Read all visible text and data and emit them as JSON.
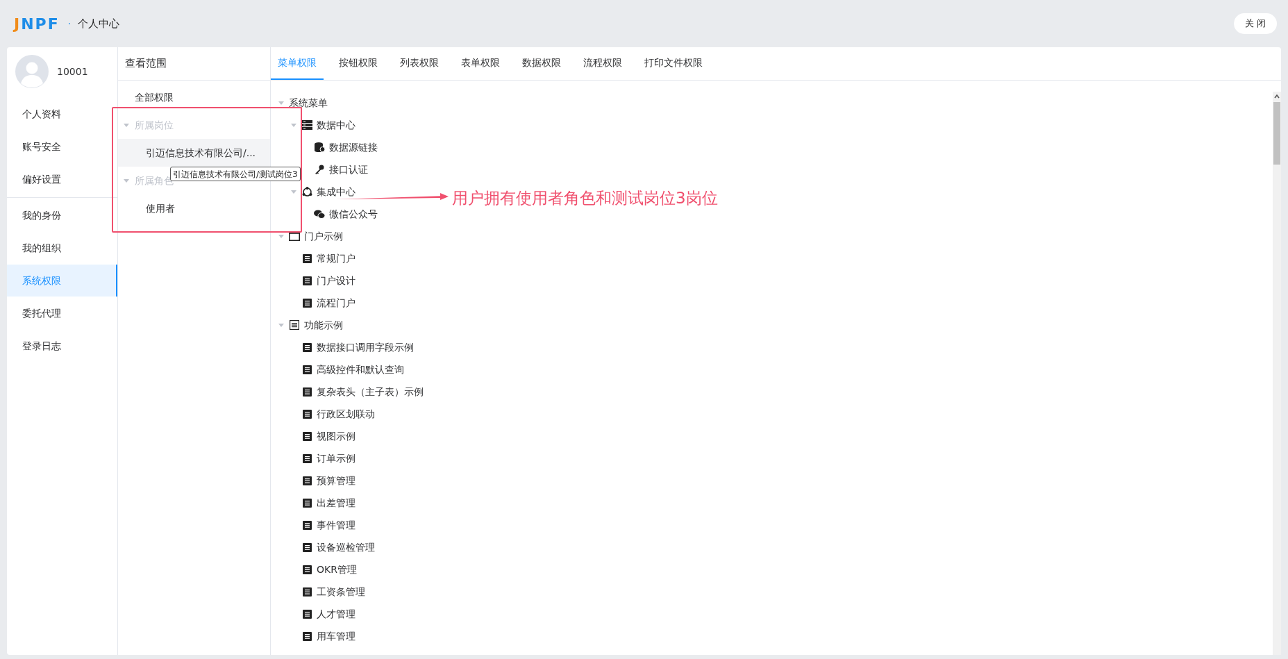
{
  "header": {
    "logo": "JNPF",
    "separator": "·",
    "title": "个人中心",
    "close_button": "关 闭"
  },
  "profile": {
    "user_id": "10001"
  },
  "sidebar": {
    "groups": [
      {
        "items": [
          {
            "label": "个人资料",
            "selected": false
          },
          {
            "label": "账号安全",
            "selected": false
          },
          {
            "label": "偏好设置",
            "selected": false
          }
        ]
      },
      {
        "items": [
          {
            "label": "我的身份",
            "selected": false
          },
          {
            "label": "我的组织",
            "selected": false
          },
          {
            "label": "系统权限",
            "selected": true
          },
          {
            "label": "委托代理",
            "selected": false
          },
          {
            "label": "登录日志",
            "selected": false
          }
        ]
      }
    ]
  },
  "scope": {
    "title": "查看范围",
    "items": [
      {
        "label": "全部权限",
        "kind": "item",
        "selected": false
      },
      {
        "label": "所属岗位",
        "kind": "group",
        "disabled": true,
        "expanded": true,
        "children": [
          {
            "label": "引迈信息技术有限公司/...",
            "selected": true
          }
        ]
      },
      {
        "label": "所属角色",
        "kind": "group",
        "disabled": true,
        "expanded": true,
        "children": [
          {
            "label": "使用者",
            "selected": false
          }
        ]
      }
    ],
    "tooltip": "引迈信息技术有限公司/测试岗位3"
  },
  "tabs": [
    {
      "label": "菜单权限",
      "selected": true
    },
    {
      "label": "按钮权限",
      "selected": false
    },
    {
      "label": "列表权限",
      "selected": false
    },
    {
      "label": "表单权限",
      "selected": false
    },
    {
      "label": "数据权限",
      "selected": false
    },
    {
      "label": "流程权限",
      "selected": false
    },
    {
      "label": "打印文件权限",
      "selected": false
    }
  ],
  "tree": [
    {
      "label": "系统菜单",
      "kind": "none",
      "expanded": true,
      "children": [
        {
          "label": "数据中心",
          "kind": "server",
          "expanded": true,
          "children": [
            {
              "label": "数据源链接",
              "kind": "database"
            },
            {
              "label": "接口认证",
              "kind": "key"
            }
          ]
        },
        {
          "label": "集成中心",
          "kind": "hub",
          "expanded": true,
          "children": [
            {
              "label": "微信公众号",
              "kind": "chat"
            }
          ]
        }
      ]
    },
    {
      "label": "门户示例",
      "kind": "window",
      "expanded": true,
      "children": [
        {
          "label": "常规门户",
          "kind": "page"
        },
        {
          "label": "门户设计",
          "kind": "page"
        },
        {
          "label": "流程门户",
          "kind": "page"
        }
      ]
    },
    {
      "label": "功能示例",
      "kind": "list",
      "expanded": true,
      "children": [
        {
          "label": "数据接口调用字段示例",
          "kind": "page"
        },
        {
          "label": "高级控件和默认查询",
          "kind": "page"
        },
        {
          "label": "复杂表头（主子表）示例",
          "kind": "page"
        },
        {
          "label": "行政区划联动",
          "kind": "page"
        },
        {
          "label": "视图示例",
          "kind": "page"
        },
        {
          "label": "订单示例",
          "kind": "page"
        },
        {
          "label": "预算管理",
          "kind": "page"
        },
        {
          "label": "出差管理",
          "kind": "page"
        },
        {
          "label": "事件管理",
          "kind": "page"
        },
        {
          "label": "设备巡检管理",
          "kind": "page"
        },
        {
          "label": "OKR管理",
          "kind": "page"
        },
        {
          "label": "工资条管理",
          "kind": "page"
        },
        {
          "label": "人才管理",
          "kind": "page"
        },
        {
          "label": "用车管理",
          "kind": "page"
        }
      ]
    }
  ],
  "annotation": {
    "text": "用户拥有使用者角色和测试岗位3岗位"
  }
}
